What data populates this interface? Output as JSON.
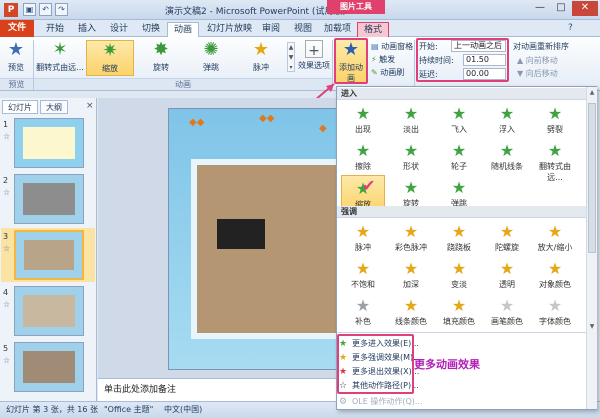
{
  "window": {
    "title": "演示文稿2 - Microsoft PowerPoint (试用版)",
    "context_tab_group": "图片工具",
    "quick_access": [
      "保存",
      "撤消",
      "重复"
    ],
    "controls": [
      "—",
      "□",
      "✕"
    ]
  },
  "tabs": [
    {
      "label": "文件",
      "name": "tab-file"
    },
    {
      "label": "开始",
      "name": "tab-home"
    },
    {
      "label": "插入",
      "name": "tab-insert"
    },
    {
      "label": "设计",
      "name": "tab-design"
    },
    {
      "label": "切换",
      "name": "tab-transitions"
    },
    {
      "label": "动画",
      "name": "tab-animations"
    },
    {
      "label": "幻灯片放映",
      "name": "tab-slideshow"
    },
    {
      "label": "审阅",
      "name": "tab-review"
    },
    {
      "label": "视图",
      "name": "tab-view"
    },
    {
      "label": "加载项",
      "name": "tab-addins"
    },
    {
      "label": "格式",
      "name": "tab-format"
    }
  ],
  "ribbon": {
    "preview_label": "预览",
    "preview_group": "预览",
    "effects": [
      {
        "label": "翻转式由远...",
        "icon": "✶"
      },
      {
        "label": "缩放",
        "icon": "✷"
      },
      {
        "label": "旋转",
        "icon": "✸"
      },
      {
        "label": "弹跳",
        "icon": "✺"
      },
      {
        "label": "脉冲",
        "icon": "★"
      }
    ],
    "effect_options_label": "效果选项",
    "animation_group": "动画",
    "add_animation_label": "添加动画",
    "animation_pane_label": "动画窗格",
    "trigger_label": "触发",
    "animation_painter_label": "动画刷",
    "start_label": "开始:",
    "start_value": "上一动画之后",
    "duration_label": "持续时间:",
    "duration_value": "01.50",
    "delay_label": "延迟:",
    "delay_value": "00.00",
    "reorder_label": "对动画重新排序",
    "move_earlier_label": "向前移动",
    "move_later_label": "向后移动"
  },
  "left_panel": {
    "tab_slides": "幻灯片",
    "tab_outline": "大纲",
    "slide_numbers": [
      "1",
      "2",
      "3",
      "4",
      "5"
    ],
    "selected_slide": "3"
  },
  "notes_placeholder": "单击此处添加备注",
  "status": {
    "slide_info": "幻灯片 第 3 张，共 16 张",
    "theme": "\"Office 主题\"",
    "language": "中文(中国)"
  },
  "gallery": {
    "section_entrance": "进入",
    "entrance": [
      {
        "label": "出现",
        "icon": "★"
      },
      {
        "label": "淡出",
        "icon": "★"
      },
      {
        "label": "飞入",
        "icon": "★"
      },
      {
        "label": "浮入",
        "icon": "★"
      },
      {
        "label": "劈裂",
        "icon": "★"
      },
      {
        "label": "擦除",
        "icon": "★"
      },
      {
        "label": "形状",
        "icon": "★"
      },
      {
        "label": "轮子",
        "icon": "★"
      },
      {
        "label": "随机线条",
        "icon": "★"
      },
      {
        "label": "翻转式由远...",
        "icon": "★"
      },
      {
        "label": "缩放",
        "icon": "★"
      },
      {
        "label": "旋转",
        "icon": "★"
      },
      {
        "label": "弹跳",
        "icon": "★"
      }
    ],
    "section_emphasis": "强调",
    "emphasis": [
      {
        "label": "脉冲",
        "icon": "★"
      },
      {
        "label": "彩色脉冲",
        "icon": "★"
      },
      {
        "label": "跷跷板",
        "icon": "★"
      },
      {
        "label": "陀螺旋",
        "icon": "★"
      },
      {
        "label": "放大/缩小",
        "icon": "★"
      },
      {
        "label": "不饱和",
        "icon": "★"
      },
      {
        "label": "加深",
        "icon": "★"
      },
      {
        "label": "变淡",
        "icon": "★"
      },
      {
        "label": "透明",
        "icon": "★"
      },
      {
        "label": "对象颜色",
        "icon": "★"
      },
      {
        "label": "补色",
        "icon": "★"
      },
      {
        "label": "线条颜色",
        "icon": "★"
      },
      {
        "label": "填充颜色",
        "icon": "★"
      },
      {
        "label": "画笔颜色",
        "icon": "★"
      },
      {
        "label": "字体颜色",
        "icon": "★"
      }
    ],
    "more": [
      {
        "label": "更多进入效果(E)...",
        "icon": "★"
      },
      {
        "label": "更多强调效果(M)...",
        "icon": "★"
      },
      {
        "label": "更多退出效果(X)...",
        "icon": "★"
      },
      {
        "label": "其他动作路径(P)...",
        "icon": "☆"
      }
    ],
    "ole_label": "OLE 操作动作(Q)..."
  },
  "callout_text": "更多动画效果",
  "colors": {
    "accent_pink": "#e0407a",
    "file_tab": "#d9411b",
    "selected": "#fbd36a",
    "callout": "#b21fb7"
  }
}
